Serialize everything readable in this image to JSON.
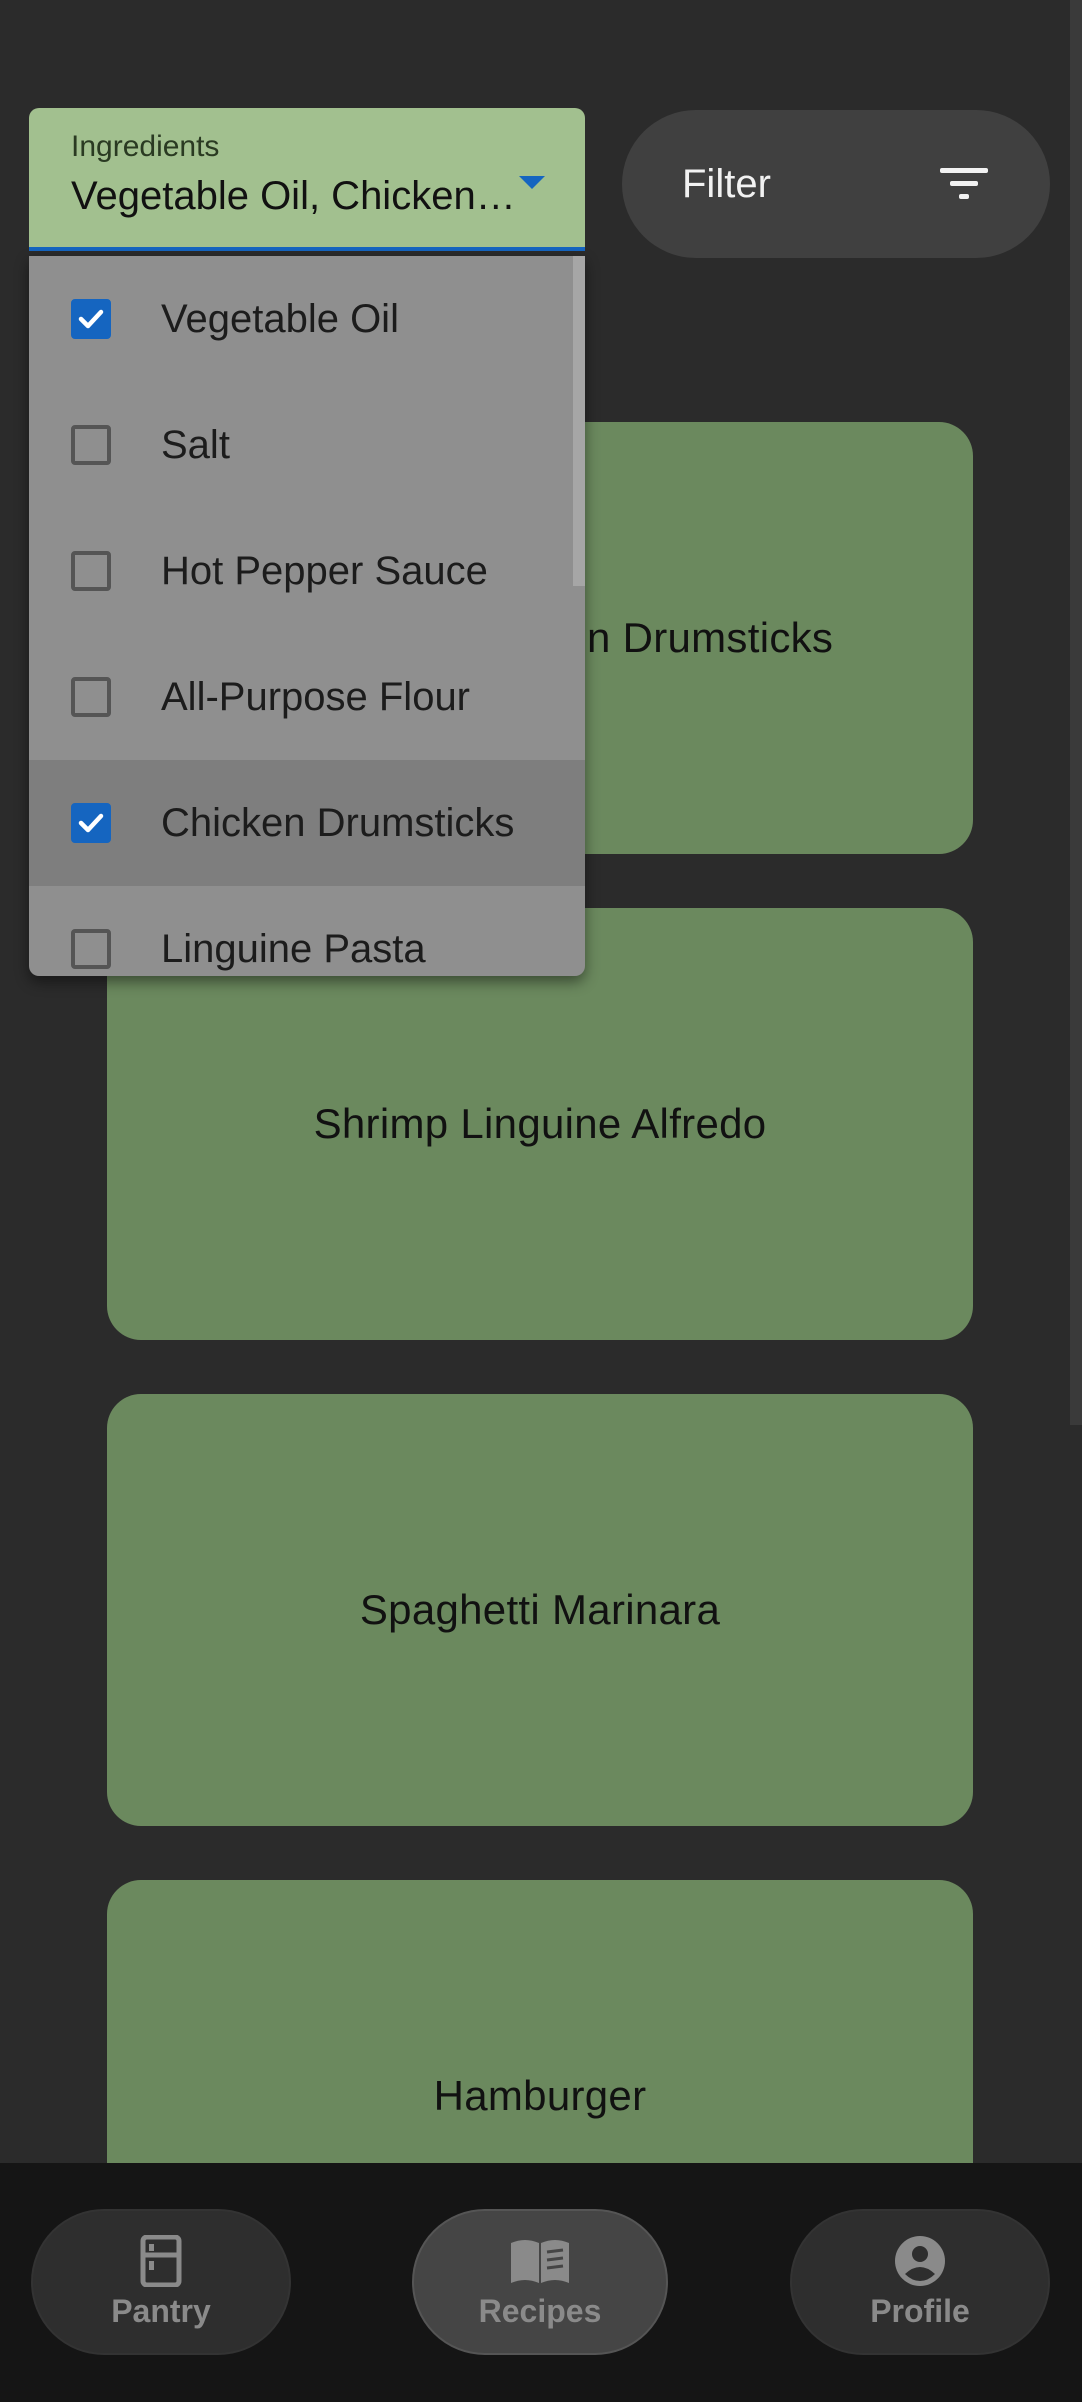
{
  "dropdown": {
    "label": "Ingredients",
    "value": "Vegetable Oil, Chicken Drumsticks",
    "options": [
      {
        "label": "Vegetable Oil",
        "checked": true
      },
      {
        "label": "Salt",
        "checked": false
      },
      {
        "label": "Hot Pepper Sauce",
        "checked": false
      },
      {
        "label": "All-Purpose Flour",
        "checked": false
      },
      {
        "label": "Chicken Drumsticks",
        "checked": true
      },
      {
        "label": "Linguine Pasta",
        "checked": false
      }
    ]
  },
  "filter": {
    "label": "Filter",
    "icon": "filter-icon"
  },
  "recipes": [
    {
      "name": "Chicken Drumsticks"
    },
    {
      "name": "Shrimp Linguine Alfredo"
    },
    {
      "name": "Spaghetti Marinara"
    },
    {
      "name": "Hamburger"
    }
  ],
  "nav": {
    "items": [
      {
        "label": "Pantry",
        "icon": "fridge-icon",
        "active": false
      },
      {
        "label": "Recipes",
        "icon": "book-icon",
        "active": true
      },
      {
        "label": "Profile",
        "icon": "account-icon",
        "active": false
      }
    ]
  },
  "colors": {
    "background": "#2b2b2b",
    "card": "#6b895e",
    "dropdown_field": "#a2c08f",
    "accent": "#1565c0",
    "nav_bar": "#151515"
  }
}
